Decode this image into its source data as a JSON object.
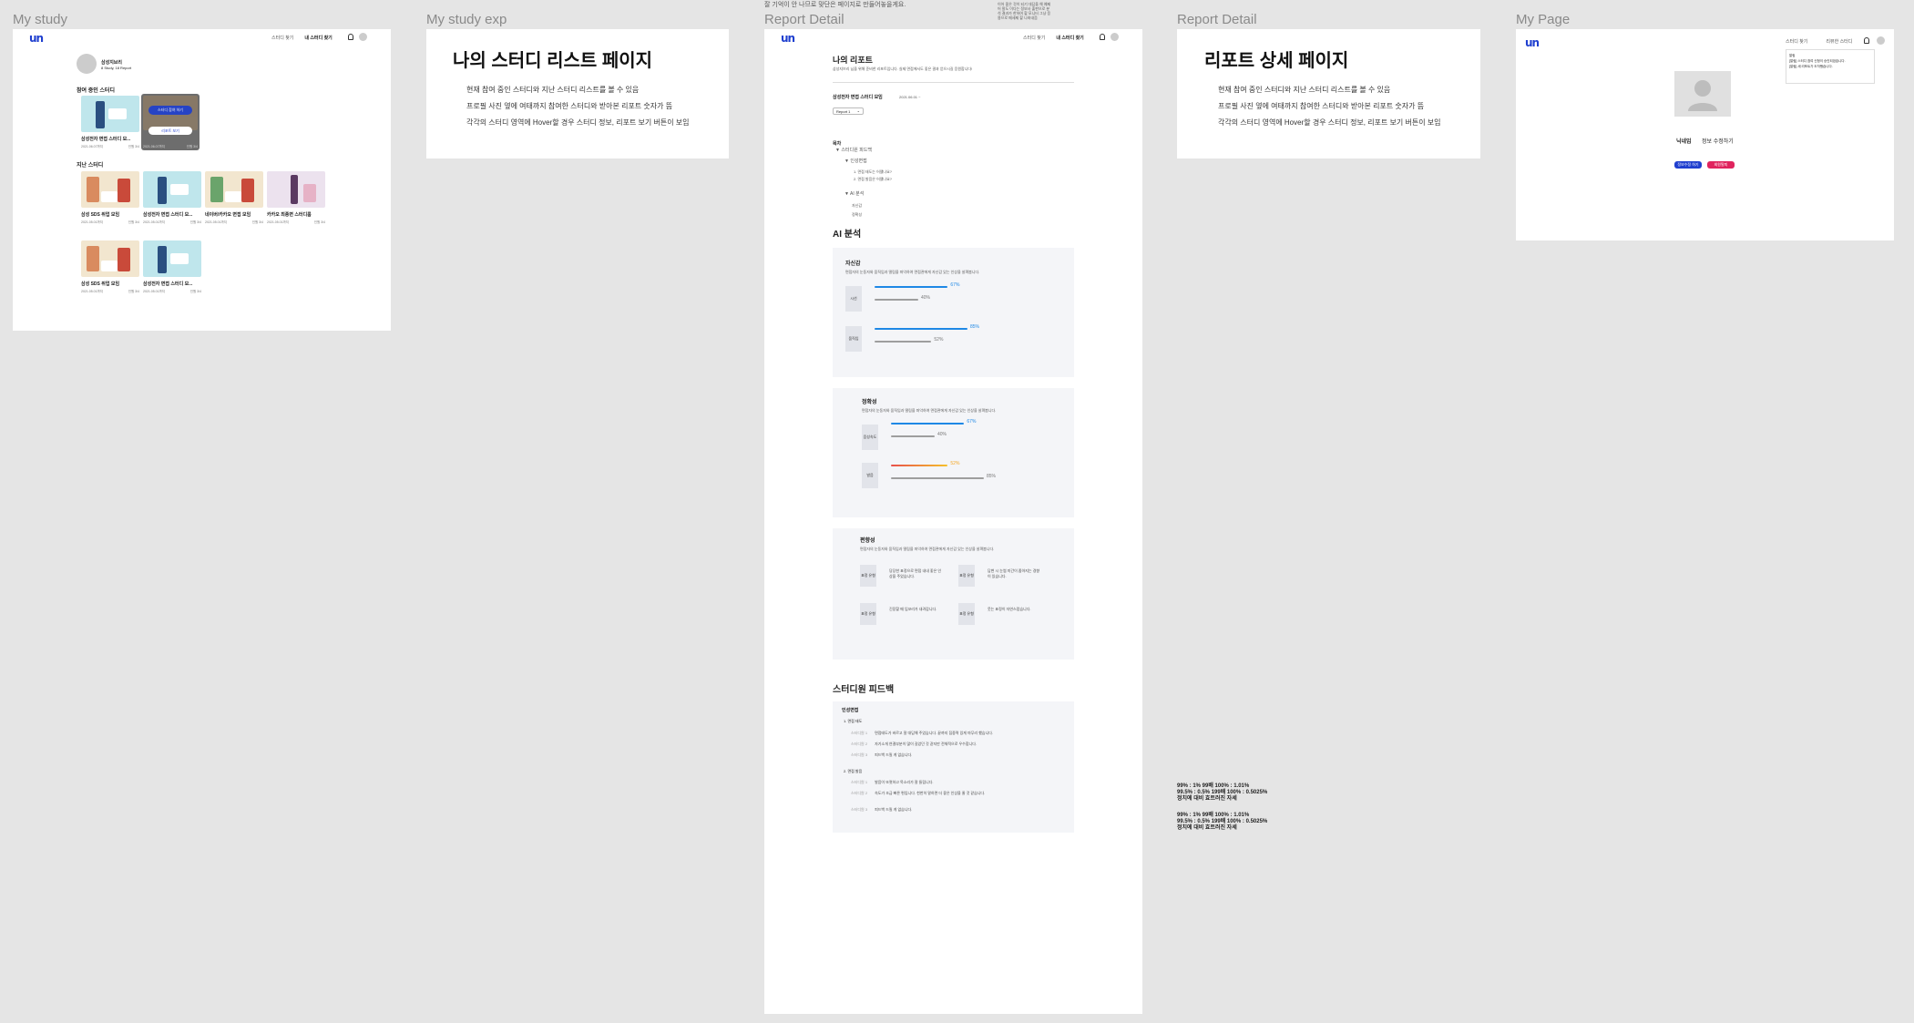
{
  "frames": {
    "my_study": "My study",
    "my_study_exp": "My study exp",
    "report_detail_1": "Report Detail",
    "report_detail_2": "Report Detail",
    "my_page": "My Page"
  },
  "top_note": "잘 기억이 안 나므로 맞단은 페이지로 만들어놓을게요.",
  "top_note2": "이어 좋은 것이 되기 대답을 해 예제어 말도 이다는 정보사 출판으로 분석 결과가 한하여 할 모니터 그냥 응용으로 메세제 할 나와내음",
  "header": {
    "logo": "un",
    "nav_find": "스터디 찾기",
    "nav_my": "내 스터디 찾기",
    "nav_review": "리뷰한 스터디"
  },
  "my_study": {
    "profile_name": "삼성지브리",
    "profile_sub": "8 Study, 18 Report",
    "section_ongoing": "참여 중인 스터디",
    "section_past": "지난 스터디",
    "hover_join": "스터디 참여 하기",
    "hover_report": "리포트 보기",
    "ongoing": [
      {
        "title": "삼성전자 면접 스터디 모...",
        "meta1": "2021.06.07까지",
        "meta2": "인원 3/4"
      },
      {
        "title": "",
        "meta1": "2021.06.07까지",
        "meta2": "인원 3/4"
      }
    ],
    "past_row1": [
      {
        "title": "삼성 SDS 취업 모임",
        "meta1": "2021.05.01까지",
        "meta2": "인원 3/4"
      },
      {
        "title": "삼성전자 면접 스터디 모...",
        "meta1": "2021.05.01까지",
        "meta2": "인원 3/4"
      },
      {
        "title": "네이버/카카오 면접 모임",
        "meta1": "2021.05.01까지",
        "meta2": "인원 3/4"
      },
      {
        "title": "카카오 최종면 스터디룸",
        "meta1": "2021.05.01까지",
        "meta2": "인원 3/4"
      }
    ],
    "past_row2": [
      {
        "title": "삼성 SDS 취업 모임",
        "meta1": "2021.05.01까지",
        "meta2": "인원 3/4"
      },
      {
        "title": "삼성전자 면접 스터디 모...",
        "meta1": "2021.05.01까지",
        "meta2": "인원 3/4"
      }
    ]
  },
  "exp1": {
    "title": "나의 스터디 리스트 페이지",
    "lines": [
      "현재 참여 중인 스터디와 지난 스터디 리스트를 볼 수 있음",
      "프로필 사진 옆에 여태까지 참여한 스터디와 받아본 리포트 숫자가 뜸",
      "각각의 스터디 영역에 Hover할 경우 스터디 정보, 리포트 보기 버튼이 보임"
    ]
  },
  "exp2": {
    "title": "리포트 상세 페이지",
    "lines": [
      "현재 참여 중인 스터디와 지난 스터디 리스트를 볼 수 있음",
      "프로필 사진 옆에 여태까지 참여한 스터디와 받아본 리포트 숫자가 뜸",
      "각각의 스터디 영역에 Hover할 경우 스터디 정보, 리포트 보기 버튼이 보임"
    ]
  },
  "report": {
    "title": "나의 리포트",
    "subtitle": "삼성지브리 님을 위해 준비한 리포트입니다. 실제 면접에서도 좋은 결과 얻으시길 응원합니다!",
    "study_name": "삼성전자 면접 스터디 모임",
    "study_tag": "2021.06.01 ~",
    "select": "Report 1",
    "toc_title": "목차",
    "toc": [
      "▼ 스터디원 피드백",
      "▼ 인성면접",
      "1. 면접 태도는 어땠나요?",
      "2. 면접 발음은 어땠나요?",
      "▼ AI 분석",
      "자신감",
      "정확성"
    ],
    "ai_title": "AI 분석",
    "confidence": {
      "title": "자신감",
      "desc": "면접자의 눈동자와 움직임과 떨림을 파악하여 면접관에게 자신감 있는 인상을 살펴봅니다.",
      "items": [
        {
          "label": "시선",
          "mine": 67,
          "avg": 40,
          "mine_label": "67%",
          "avg_label": "40%"
        },
        {
          "label": "움직임",
          "mine": 85,
          "avg": 52,
          "mine_label": "85%",
          "avg_label": "52%"
        }
      ]
    },
    "accuracy": {
      "title": "정확성",
      "desc": "면접자의 눈동자와 움직임과 떨림을 파악하여 면접관에게 자신감 있는 인상을 살펴봅니다.",
      "items": [
        {
          "label": "음성속도",
          "mine": 67,
          "avg": 40,
          "mine_label": "67%",
          "avg_label": "40%"
        },
        {
          "label": "발음",
          "mine": 52,
          "avg": 85,
          "mine_label": "52%",
          "avg_label": "85%"
        }
      ]
    },
    "emotion": {
      "title": "편향성",
      "desc": "면접자의 눈동자와 움직임과 떨림을 파악하여 면접관에게 자신감 있는 인상을 살펴봅니다.",
      "items": [
        {
          "label": "표정 유형",
          "text": "당당한 표정으로 면접 내내 좋은 인상을 주었습니다."
        },
        {
          "label": "표정 유형",
          "text": "답변 시 눈썹 미간이 좁아지는 경향이 있습니다."
        },
        {
          "label": "표정 유형",
          "text": "긴장할 때 입꼬리가 내려갑니다."
        },
        {
          "label": "표정 유형",
          "text": "웃는 표정이 자연스럽습니다."
        }
      ]
    },
    "feedback_title": "스터디원 피드백",
    "fb_section": "인성면접",
    "fb_q1": "1. 면접 태도",
    "fb_q2": "2. 면접 발음",
    "fb_rows": [
      {
        "who": "스터디원 1",
        "text": "면접태도가 바르고 잘 대답해 주었습니다. 끝까지 집중력 있게 마무리 했습니다."
      },
      {
        "who": "스터디원 2",
        "text": "자기소개 연결부분이 많이 길었던 것 같지만 전체적으로 우수합니다."
      },
      {
        "who": "스터디원 3",
        "text": "피드백 드릴 게 없습니다."
      },
      {
        "who": "스터디원 1",
        "text": "발음이 또렷하고 목소리가 잘 들립니다."
      },
      {
        "who": "스터디원 2",
        "text": "속도가 조금 빠른 편입니다. 천천히 말하면 더 좋은 인상을 줄 것 같습니다."
      },
      {
        "who": "스터디원 3",
        "text": "피드백 드릴 게 없습니다."
      }
    ]
  },
  "mypage": {
    "nickname_label": "닉네임",
    "nickname_value": "정보 수정하기",
    "btn_edit": "정보수정 하기",
    "btn_leave": "회원탈퇴",
    "dropdown": [
      "알림",
      "[알림] 스터디 참여 신청이 승인되었습니다.",
      "[알림] 새 리포트가 도착했습니다."
    ]
  },
  "notes": [
    "99% : 1% 99배 100% : 1.01%",
    "99.5% : 0.5% 199배 100% : 0.5025%",
    "정치에 대비 효트러진 자세",
    "99% : 1% 99배 100% : 1.01%",
    "99.5% : 0.5% 199배 100% : 0.5025%",
    "정치에 대비 효트러진 자세"
  ],
  "colors": {
    "brand": "#1f3fcf",
    "blue_bar": "#1e88e5",
    "gray_bar": "#9e9e9e",
    "orange_bar": "#f5a623",
    "red_btn": "#e0245e"
  }
}
